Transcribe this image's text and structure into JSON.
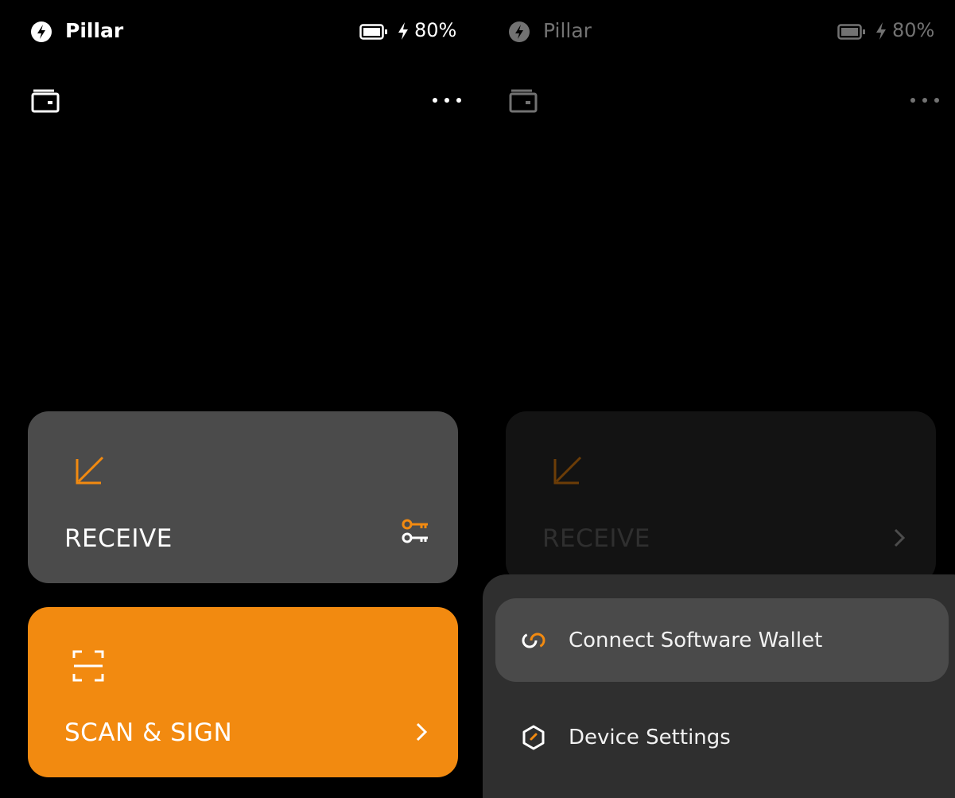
{
  "status_bar": {
    "app_name": "Pillar",
    "battery": "80%"
  },
  "home": {
    "receive_label": "RECEIVE",
    "scan_label": "SCAN & SIGN"
  },
  "menu": {
    "items": [
      {
        "label": "Connect Software Wallet",
        "icon": "link-icon",
        "active": true
      },
      {
        "label": "Device Settings",
        "icon": "hexagon-settings-icon",
        "active": false
      }
    ]
  },
  "colors": {
    "accent": "#f28a10",
    "background": "#000000",
    "card": "#4b4b4b",
    "sheet": "#2f2f2f"
  }
}
